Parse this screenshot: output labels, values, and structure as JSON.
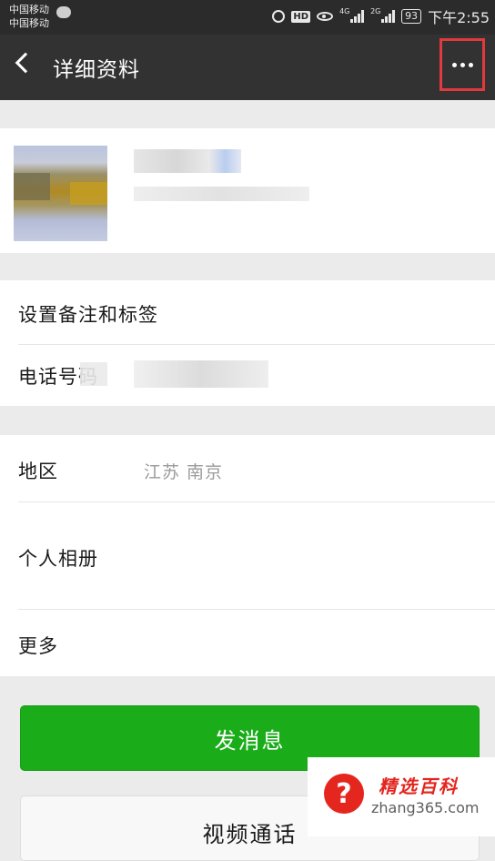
{
  "status_bar": {
    "carrier_1": "中国移动",
    "carrier_2": "中国移动",
    "hd": "HD",
    "net_1": "4G",
    "net_2": "2G",
    "battery": "93",
    "time": "下午2:55"
  },
  "header": {
    "title": "详细资料",
    "more_label": "···",
    "highlight_color": "#e03a3e"
  },
  "rows": {
    "remark_tags": "设置备注和标签",
    "phone": "电话号码",
    "region_label": "地区",
    "region_value": "江苏  南京",
    "album": "个人相册",
    "more": "更多"
  },
  "buttons": {
    "send_message": "发消息",
    "video_call": "视频通话",
    "send_color": "#1aad19"
  },
  "watermark": {
    "symbol": "?",
    "title": "精选百科",
    "url": "zhang365.com"
  }
}
